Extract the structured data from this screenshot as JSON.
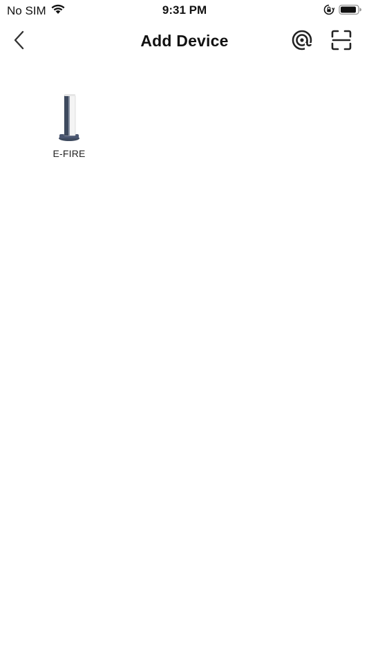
{
  "status_bar": {
    "carrier": "No SIM",
    "time": "9:31 PM",
    "icons": [
      "wifi-icon",
      "orientation-lock-icon",
      "battery-icon"
    ]
  },
  "nav": {
    "back_icon": "chevron-left-icon",
    "title": "Add Device",
    "actions": [
      "nearby-scan-icon",
      "qr-scan-icon"
    ]
  },
  "devices": [
    {
      "label": "E-FIRE",
      "icon": "tower-device-icon"
    }
  ],
  "colors": {
    "background": "#ffffff",
    "text": "#111111",
    "device_body": "#f2f2f2",
    "device_accent": "#3e4a5e"
  }
}
